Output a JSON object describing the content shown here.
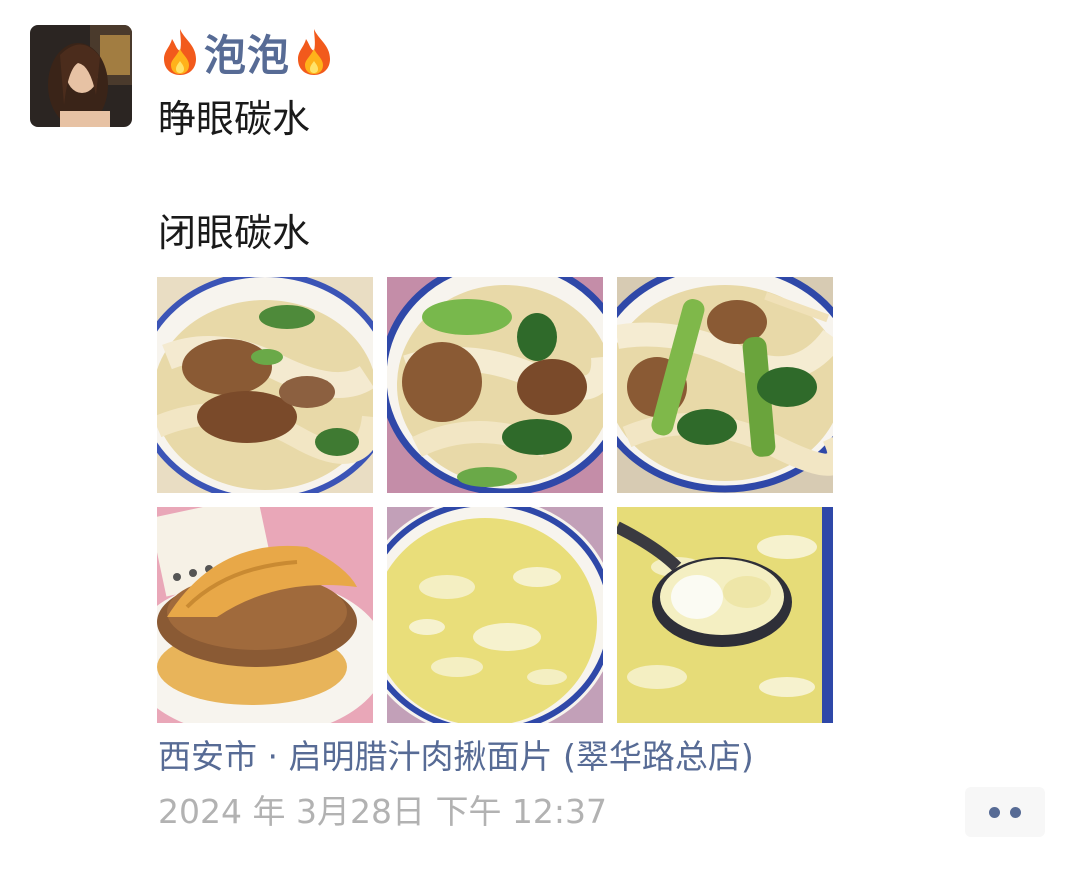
{
  "author": {
    "name": "泡泡",
    "decoration_icon": "fire-icon"
  },
  "post": {
    "line1": "睁眼碳水",
    "line2": "闭眼碳水"
  },
  "photos": [
    {
      "name": "noodle-bowl-photo-1",
      "subject": "noodles"
    },
    {
      "name": "noodle-bowl-photo-2",
      "subject": "noodles"
    },
    {
      "name": "noodle-bowl-photo-3",
      "subject": "noodles"
    },
    {
      "name": "roujiamo-photo",
      "subject": "roujiamo"
    },
    {
      "name": "egg-soup-photo-1",
      "subject": "egg-soup"
    },
    {
      "name": "egg-soup-photo-2",
      "subject": "egg-soup"
    }
  ],
  "location": "西安市 · 启明腊汁肉揪面片 (翠华路总店)",
  "timestamp": "2024 年 3月28日 下午 12:37",
  "more_button": {
    "icon": "more-dots-icon"
  },
  "colors": {
    "link": "#576b95",
    "text": "#1a1a1a",
    "meta": "#b2b2b2",
    "background": "#ffffff"
  }
}
